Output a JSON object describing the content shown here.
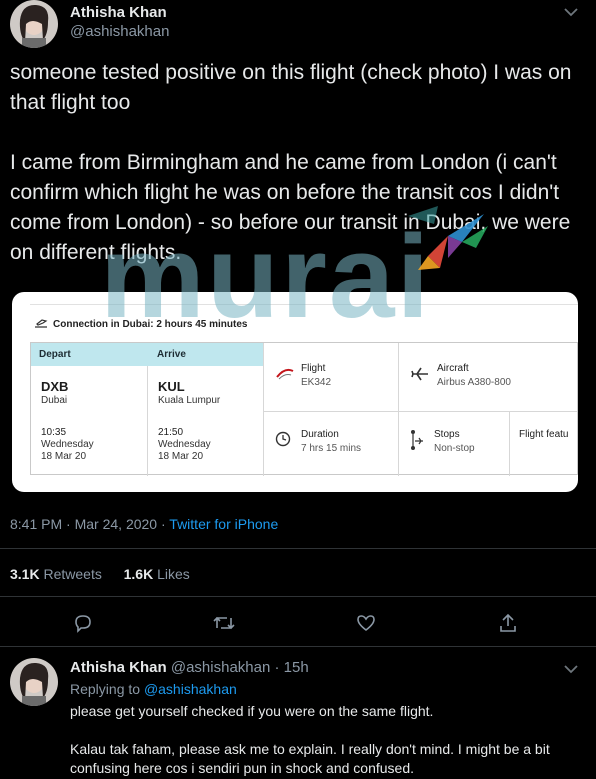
{
  "tweet": {
    "author_name": "Athisha Khan",
    "author_handle": "@ashishakhan",
    "text": "someone tested positive on this flight (check photo) I was on that flight too\n\nI came from Birmingham and he came from London (i can't confirm which flight he was on before the transit cos I didn't come from London) - so before our transit in Dubai, we were on different flights.",
    "time": "8:41 PM",
    "date": "Mar 24, 2020",
    "sep": "·",
    "source": "Twitter for iPhone",
    "retweets_count": "3.1K",
    "retweets_label": "Retweets",
    "likes_count": "1.6K",
    "likes_label": "Likes"
  },
  "flight_card": {
    "connection": "Connection in Dubai: 2 hours 45 minutes",
    "depart_label": "Depart",
    "arrive_label": "Arrive",
    "depart_code": "DXB",
    "depart_city": "Dubai",
    "depart_time": "10:35",
    "depart_day": "Wednesday",
    "depart_date": "18 Mar 20",
    "arrive_code": "KUL",
    "arrive_city": "Kuala Lumpur",
    "arrive_time": "21:50",
    "arrive_day": "Wednesday",
    "arrive_date": "18 Mar 20",
    "flight_label": "Flight",
    "flight_value": "EK342",
    "aircraft_label": "Aircraft",
    "aircraft_value": "Airbus A380-800",
    "duration_label": "Duration",
    "duration_value": "7 hrs 15 mins",
    "stops_label": "Stops",
    "stops_value": "Non-stop",
    "features_label": "Flight featu"
  },
  "watermark": "murai",
  "reply": {
    "author_name": "Athisha Khan",
    "author_handle": "@ashishakhan",
    "sep": "·",
    "age": "15h",
    "replying_prefix": "Replying to",
    "replying_handle": "@ashishakhan",
    "text": "please get yourself checked if you were on the same flight.\n\nKalau tak faham, please ask me to explain. I really don't mind. I might be a bit confusing here cos i sendiri pun in shock and confused."
  },
  "colors": {
    "accent": "#1d9bf0",
    "background": "#000000",
    "muted": "#8b98a5"
  },
  "icons": [
    "chevron-down-icon",
    "reply-icon",
    "retweet-icon",
    "like-icon",
    "share-icon",
    "airplane-icon",
    "emirates-logo-icon",
    "clock-icon",
    "stops-icon",
    "connection-icon"
  ]
}
